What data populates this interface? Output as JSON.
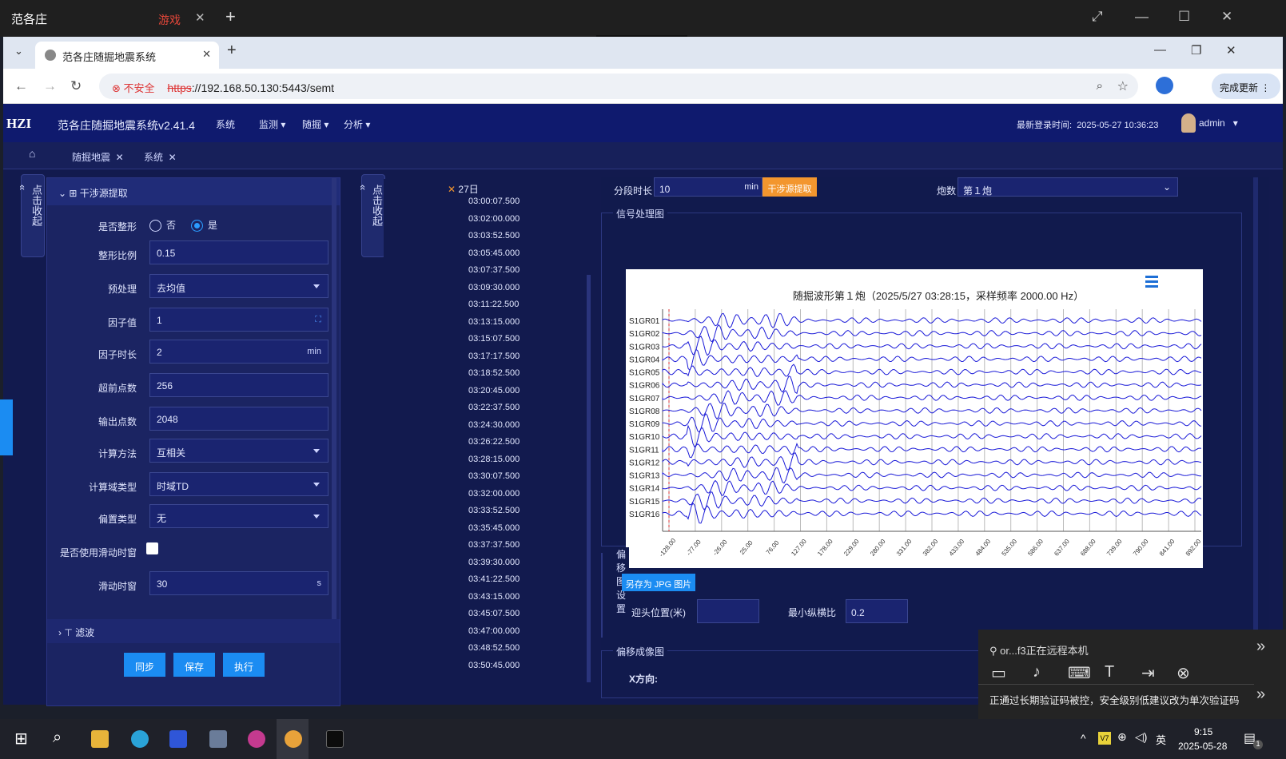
{
  "remote_titlebar": {
    "app_name": "范各庄",
    "tab2": "游戏",
    "close": "✕",
    "plus": "+"
  },
  "browser": {
    "tab_title": "范各庄随掘地震系统",
    "tab_close": "✕",
    "new_tab": "+",
    "insecure_label": "不安全",
    "url_scheme": "https",
    "url_rest": "://192.168.50.130:5443/semt",
    "update_button": "完成更新"
  },
  "app": {
    "logo": "HZI",
    "title": "范各庄随掘地震系统v2.41.4",
    "nav": [
      "系统",
      "监测",
      "随掘",
      "分析"
    ],
    "login_label": "最新登录时间:",
    "login_time": "2025-05-27 10:36:23",
    "user": "admin"
  },
  "page_tabs": [
    "随掘地震",
    "系统"
  ],
  "collapse_tab_label": "点击收起",
  "left_panel": {
    "section_title": "干涉源提取",
    "fields": [
      {
        "label": "是否整形",
        "type": "radio",
        "options": [
          "否",
          "是"
        ],
        "selected": "是"
      },
      {
        "label": "整形比例",
        "value": "0.15"
      },
      {
        "label": "预处理",
        "value": "去均值",
        "type": "select"
      },
      {
        "label": "因子值",
        "value": "1"
      },
      {
        "label": "因子时长",
        "value": "2",
        "suffix": "min"
      },
      {
        "label": "超前点数",
        "value": "256"
      },
      {
        "label": "输出点数",
        "value": "2048"
      },
      {
        "label": "计算方法",
        "value": "互相关",
        "type": "select"
      },
      {
        "label": "计算域类型",
        "value": "时域TD",
        "type": "select"
      },
      {
        "label": "偏置类型",
        "value": "无",
        "type": "select"
      },
      {
        "label": "是否使用滑动时窗",
        "type": "checkbox",
        "checked": false
      },
      {
        "label": "滑动时窗",
        "value": "30",
        "suffix": "s"
      }
    ],
    "filter_title": "滤波",
    "buttons": [
      "同步",
      "保存",
      "执行"
    ]
  },
  "time_list": {
    "day": "27日",
    "times": [
      "03:00:07.500",
      "03:02:00.000",
      "03:03:52.500",
      "03:05:45.000",
      "03:07:37.500",
      "03:09:30.000",
      "03:11:22.500",
      "03:13:15.000",
      "03:15:07.500",
      "03:17:17.500",
      "03:18:52.500",
      "03:20:45.000",
      "03:22:37.500",
      "03:24:30.000",
      "03:26:22.500",
      "03:28:15.000",
      "03:30:07.500",
      "03:32:00.000",
      "03:33:52.500",
      "03:35:45.000",
      "03:37:37.500",
      "03:39:30.000",
      "03:41:22.500",
      "03:43:15.000",
      "03:45:07.500",
      "03:47:00.000",
      "03:48:52.500",
      "03:50:45.000"
    ]
  },
  "right_panel": {
    "segment_label": "分段时长",
    "segment_value": "10",
    "segment_unit": "min",
    "extract_button": "干涉源提取",
    "shot_label": "炮数",
    "shot_value": "第１炮",
    "signal_section": "信号处理图",
    "offset_section": "偏移图设置",
    "save_jpg": "另存为 JPG 图片",
    "face_pos_label": "迎头位置(米)",
    "face_pos_value": "",
    "min_ratio_label": "最小纵横比",
    "min_ratio_value": "0.2",
    "image_section": "偏移成像图",
    "x_dir": "X方向:"
  },
  "chart_data": {
    "type": "line",
    "title": "随掘波形第１炮（2025/5/27 03:28:15，采样频率 2000.00 Hz）",
    "channels": [
      "S1GR01",
      "S1GR02",
      "S1GR03",
      "S1GR04",
      "S1GR05",
      "S1GR06",
      "S1GR07",
      "S1GR08",
      "S1GR09",
      "S1GR10",
      "S1GR11",
      "S1GR12",
      "S1GR13",
      "S1GR14",
      "S1GR15",
      "S1GR16"
    ],
    "x_ticks": [
      "-128.00",
      "-77.00",
      "-26.00",
      "25.00",
      "76.00",
      "127.00",
      "178.00",
      "229.00",
      "280.00",
      "331.00",
      "382.00",
      "433.00",
      "484.00",
      "535.00",
      "586.00",
      "637.00",
      "688.00",
      "739.00",
      "790.00",
      "841.00",
      "892.00"
    ],
    "series_color": "#1a1ad8",
    "menu_color": "#1d6fd6"
  },
  "remote_popup": {
    "status": "or...f3正在远程本机",
    "notice": "正通过长期验证码被控，安全级别低建议改为单次验证码"
  },
  "taskbar": {
    "ime_badge": "V7",
    "lang": "英",
    "time": "9:15",
    "date": "2025-05-28",
    "notify_count": "1"
  },
  "colors": {
    "header": "#0f1a6e",
    "panel": "#1b2462",
    "accent": "#1b8cf2",
    "orange": "#f3962e"
  }
}
